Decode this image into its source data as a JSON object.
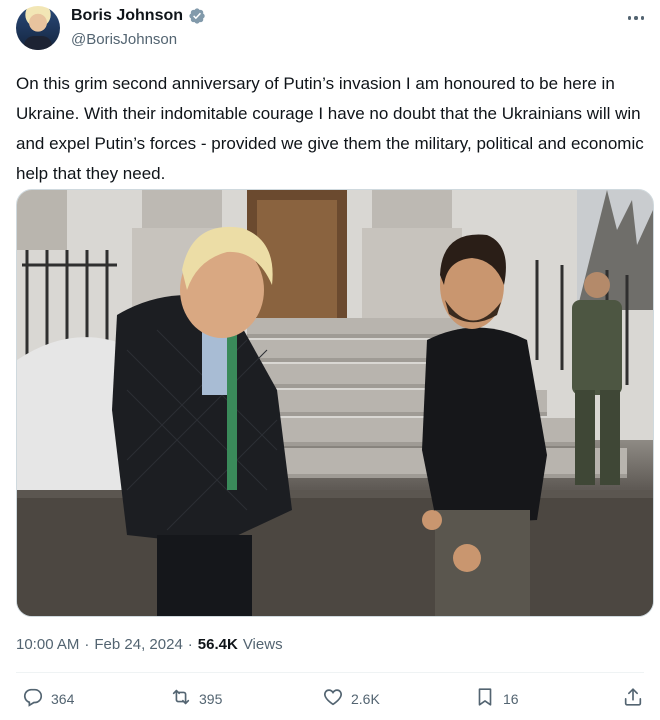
{
  "author": {
    "display_name": "Boris Johnson",
    "handle": "@BorisJohnson",
    "verified": true
  },
  "tweet": {
    "text": "On this grim second anniversary of Putin’s invasion I am honoured to be here in Ukraine. With their indomitable courage I have no doubt that the Ukrainians will win and expel Putin’s forces - provided we give them the military, political and economic help that they need."
  },
  "meta": {
    "time": "10:00 AM",
    "separator": "·",
    "date": "Feb 24, 2024",
    "views_count": "56.4K",
    "views_label": "Views"
  },
  "actions": {
    "replies": "364",
    "reposts": "395",
    "likes": "2.6K",
    "bookmarks": "16"
  },
  "icons": {
    "verified": "verified-badge-icon",
    "more": "more-horizontal-icon",
    "reply": "reply-icon",
    "repost": "repost-icon",
    "like": "heart-icon",
    "bookmark": "bookmark-icon",
    "share": "share-icon"
  },
  "colors": {
    "text": "#0f1419",
    "secondary": "#536471",
    "verified": "#829aab",
    "divider": "#eff3f4"
  }
}
